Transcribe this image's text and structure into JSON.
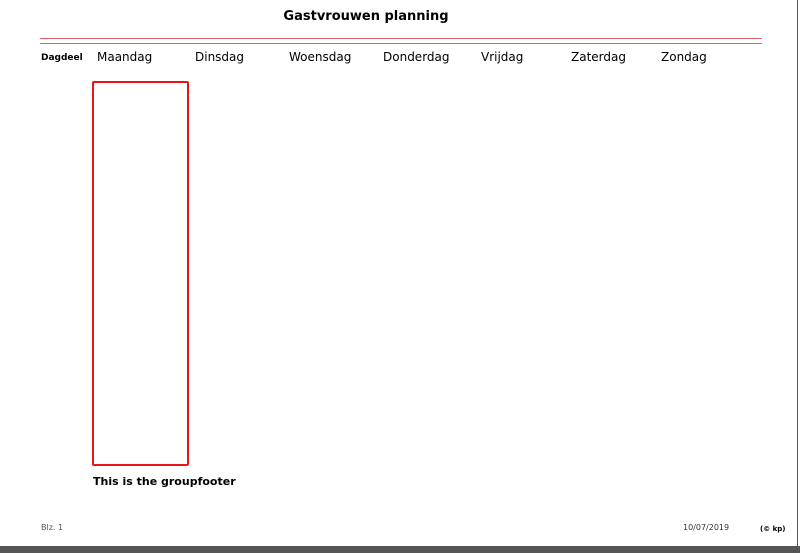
{
  "report": {
    "title": "Gastvrouwen planning",
    "rule_color": "#e0606a",
    "accent_color": "#e8141b"
  },
  "columns": {
    "dagdeel": "Dagdeel",
    "days": [
      "Maandag",
      "Dinsdag",
      "Woensdag",
      "Donderdag",
      "Vrijdag",
      "Zaterdag",
      "Zondag"
    ]
  },
  "group": {
    "footer_text": "This is the groupfooter"
  },
  "page_footer": {
    "page_label": "Blz. 1",
    "date": "10/07/2019",
    "copyright": "(© kp)"
  }
}
